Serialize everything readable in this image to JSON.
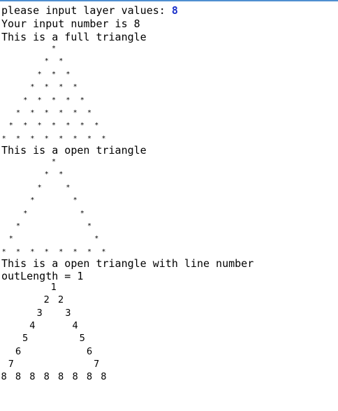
{
  "console": {
    "prompt_label": "please input layer values: ",
    "prompt_value": "8",
    "echo_line": "Your input number is 8",
    "full_heading": "This is a full triangle",
    "open_heading": "This is a open triangle",
    "numbered_heading": "This is a open triangle with line number",
    "out_length_line": "outLength = 1",
    "star_glyph": "*",
    "layers": 8
  },
  "colors": {
    "text": "#000000",
    "input": "#1a2fc9",
    "top_border": "#4f8fd0",
    "background": "#ffffff"
  }
}
